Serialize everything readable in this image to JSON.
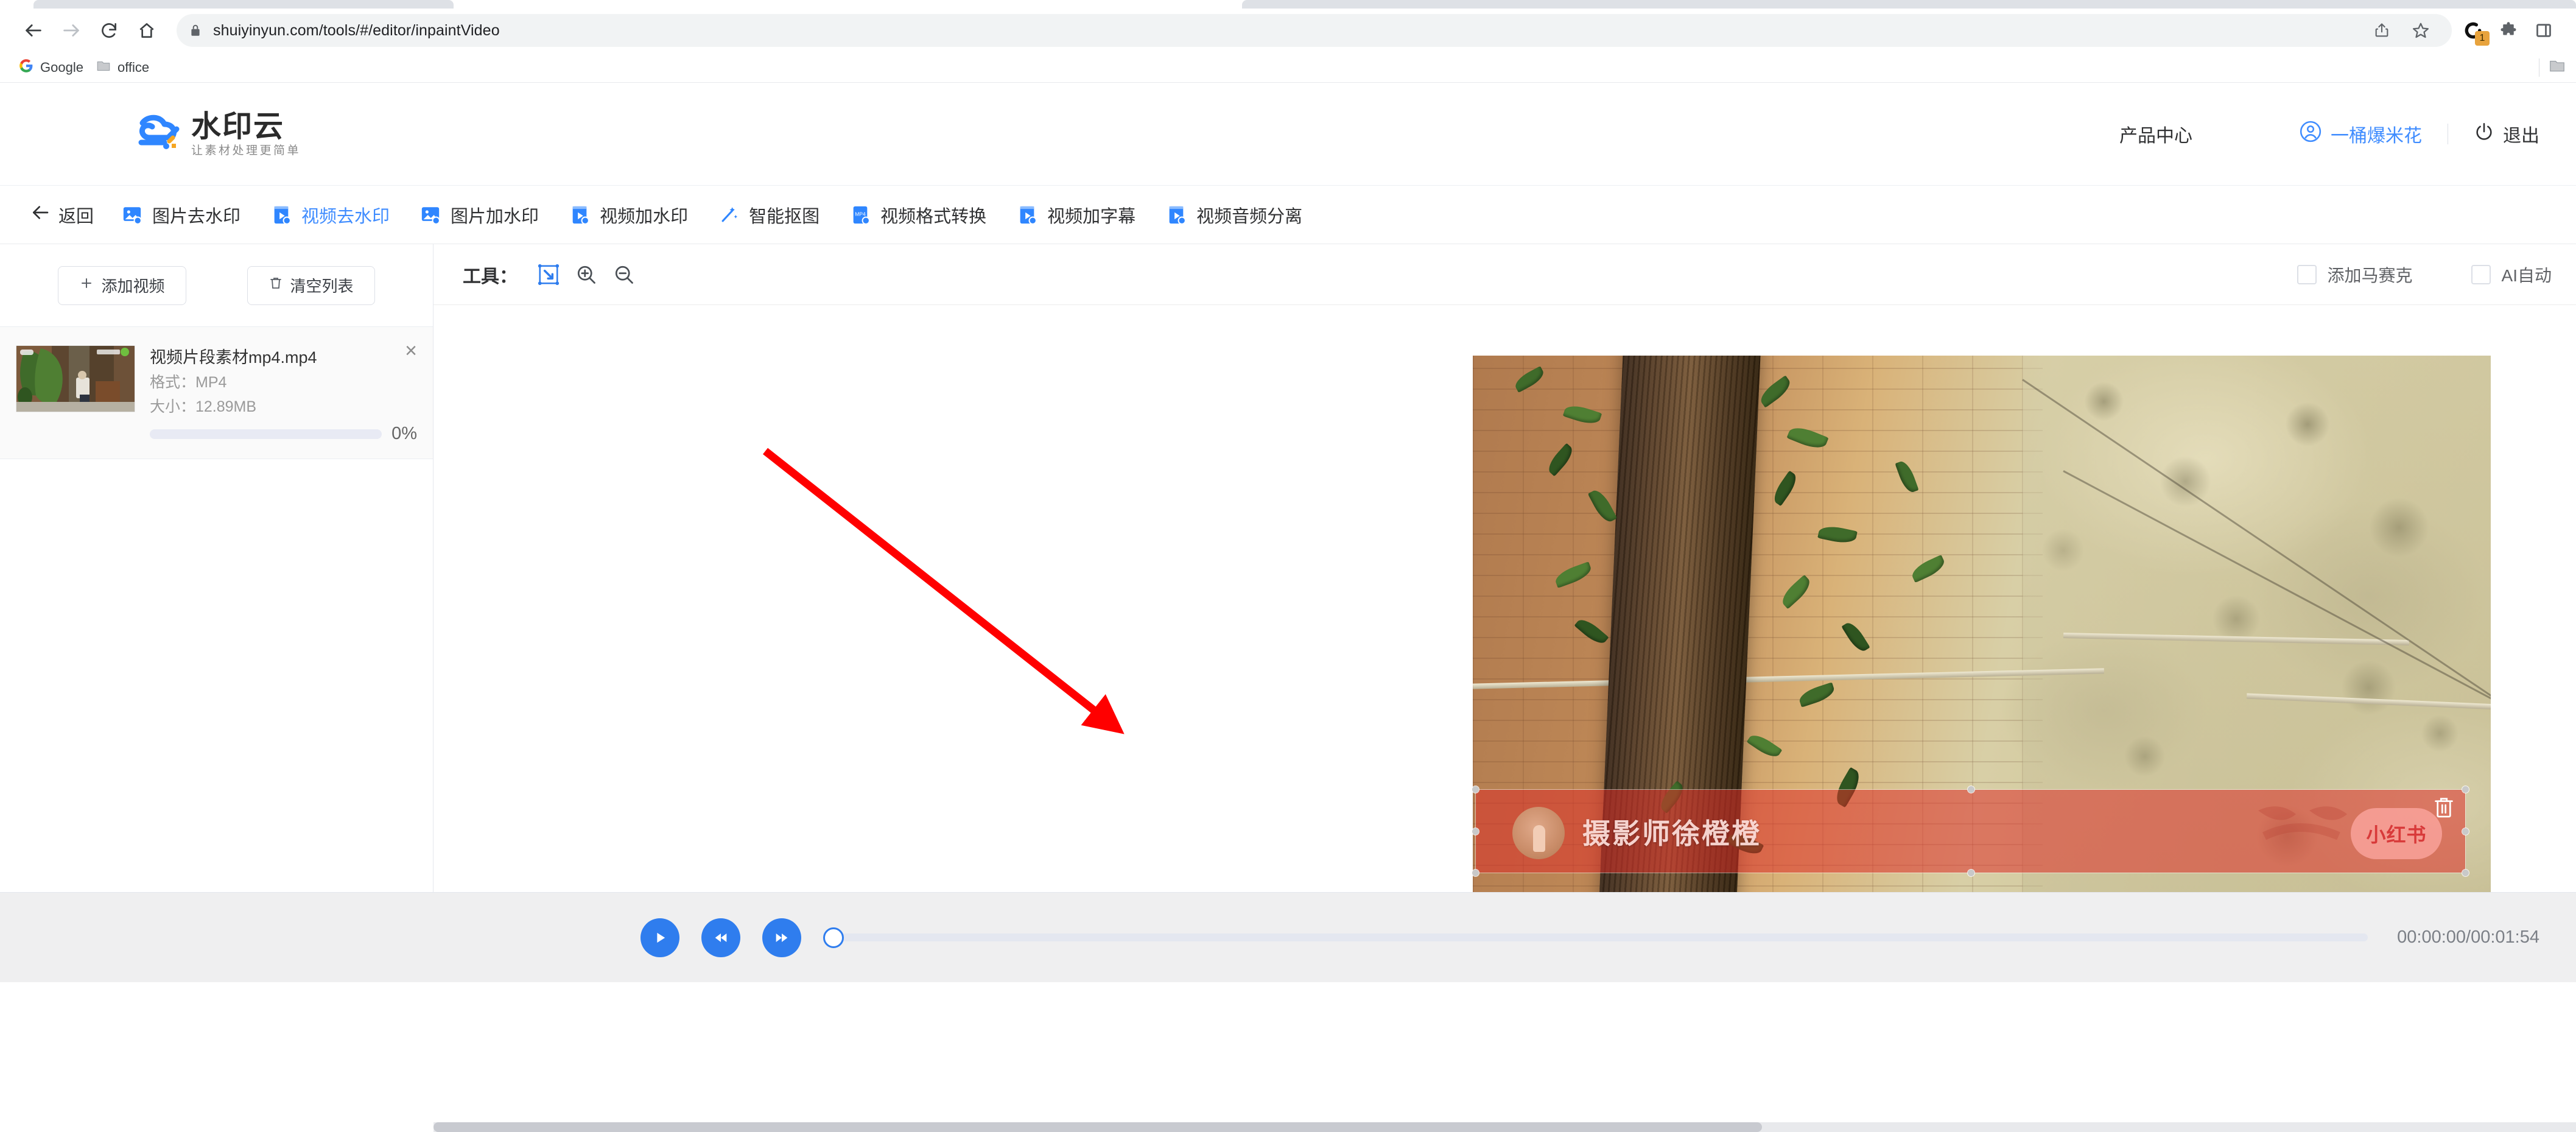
{
  "browser": {
    "url": "shuiyinyun.com/tools/#/editor/inpaintVideo",
    "icons": {
      "back": "back-arrow-icon",
      "forward": "forward-arrow-icon",
      "reload": "reload-icon",
      "home": "home-icon",
      "lock": "lock-icon",
      "share": "share-icon",
      "bookmark": "star-icon",
      "extension_circle": "circle-extension-icon",
      "puzzle": "puzzle-extension-icon",
      "sidepanel": "side-panel-icon",
      "folder": "folder-icon"
    },
    "extension_badge_count": "1",
    "bookmarks": [
      {
        "label": "Google",
        "icon": "google-icon"
      },
      {
        "label": "office",
        "icon": "folder-icon"
      }
    ]
  },
  "site_header": {
    "logo_title": "水印云",
    "logo_subtitle": "让素材处理更简单",
    "product_center": "产品中心",
    "user_name": "一桶爆米花",
    "logout": "退出"
  },
  "nav": {
    "back_label": "返回",
    "items": [
      {
        "label": "图片去水印",
        "active": false
      },
      {
        "label": "视频去水印",
        "active": true
      },
      {
        "label": "图片加水印",
        "active": false
      },
      {
        "label": "视频加水印",
        "active": false
      },
      {
        "label": "智能抠图",
        "active": false
      },
      {
        "label": "视频格式转换",
        "active": false
      },
      {
        "label": "视频加字幕",
        "active": false
      },
      {
        "label": "视频音频分离",
        "active": false
      }
    ]
  },
  "sidebar": {
    "add_video_label": "添加视频",
    "clear_list_label": "清空列表",
    "files": [
      {
        "name": "视频片段素材mp4.mp4",
        "format_label": "格式：MP4",
        "size_label": "大小：12.89MB",
        "progress_percent": "0%",
        "progress_value": 0
      }
    ]
  },
  "toolbar": {
    "label": "工具：",
    "tools": [
      {
        "name": "selection-box",
        "active": true
      },
      {
        "name": "zoom-in",
        "active": false
      },
      {
        "name": "zoom-out",
        "active": false
      }
    ],
    "checkboxes": [
      {
        "label": "添加马赛克",
        "checked": false
      },
      {
        "label": "AI自动",
        "checked": false
      }
    ]
  },
  "canvas": {
    "watermark_text": "摄影师徐橙橙",
    "watermark_badge": "小红书",
    "selection_delete_icon": "trash-icon",
    "annotation_arrow_color": "#ff0000"
  },
  "player": {
    "play_label": "play-icon",
    "rewind_label": "rewind-icon",
    "forward_label": "fast-forward-icon",
    "time_display": "00:00:00/00:01:54",
    "progress_value": 0
  },
  "colors": {
    "accent": "#3f8cff",
    "player_accent": "#2f7dee",
    "selection_red": "#dc3028",
    "annotation_red": "#ff0000"
  }
}
